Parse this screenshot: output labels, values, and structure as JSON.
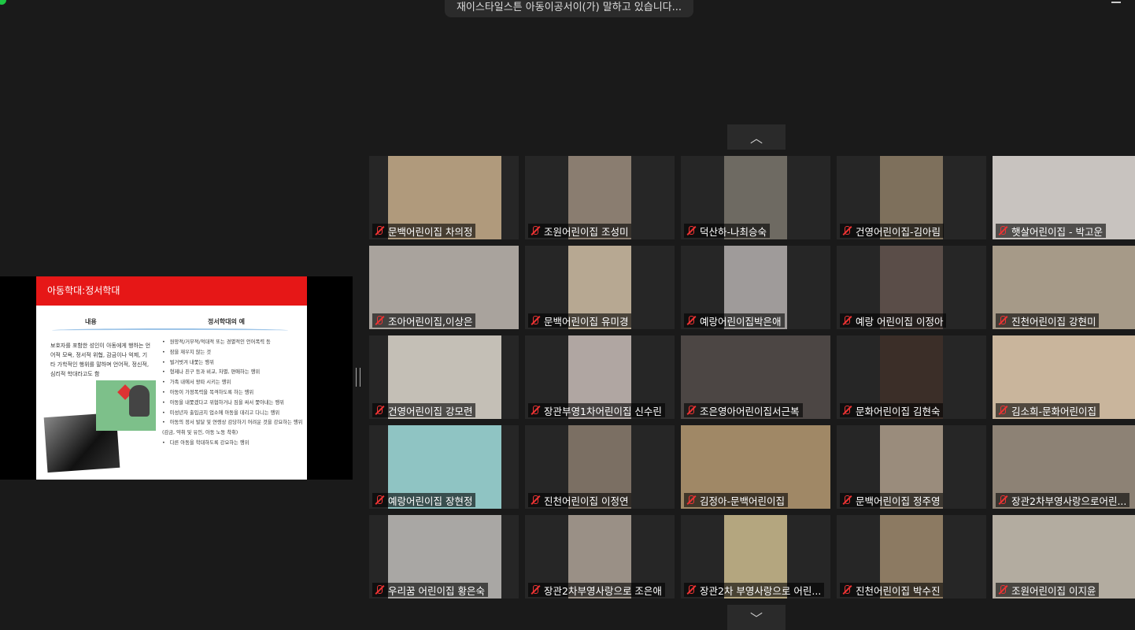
{
  "banner": {
    "text": "재이스타일스튼 아동이공서이(가) 말하고 있습니다..."
  },
  "slide": {
    "title": "아동학대:정서학대",
    "col_left_header": "내용",
    "col_right_header": "정서학대의 예",
    "left_text": "보호자를 포함한 성인이 아동에게 행하는 언어적 모욕, 정서적 위협, 감금이나 억제, 기타 가학적인 행위를 말하며 언어적, 정신적, 심리적 학대라고도 함",
    "items": [
      "원망적/거부적/적대적 또는 경멸적인 언어폭력 등",
      "잠을 재우지 않는 것",
      "벌거벗겨 내쫓는 행위",
      "형제나 친구 등과 비교, 차별, 편애하는 행위",
      "가족 내에서 왕따 시키는 행위",
      "아동이 가정폭력을 목격하도록 하는 행위",
      "아동을 내쫓겠다고 위협하거나 짐을 싸서 쫓아내는 행위",
      "미성년자 출입금지 업소에 아동을 데리고 다니는 행위",
      "아동의 정서 발달 및 연령상 감당하기 어려운 것을 강요하는 행위(감금, 약취 및 유인, 아동 노동 착취)",
      "다른 아동을 학대하도록 강요하는 행위"
    ]
  },
  "participants": [
    {
      "name": "문백어린이집 차의정",
      "bg": "#b09a7c"
    },
    {
      "name": "조원어린이집 조성미",
      "bg": "#8a7d70"
    },
    {
      "name": "덕산하-나최승숙",
      "bg": "#6e6a62"
    },
    {
      "name": "건영어린이집-김아림",
      "bg": "#7e705c"
    },
    {
      "name": "햇살어린이집 - 박고운",
      "bg": "#c8c3bf"
    },
    {
      "name": "조아어린이집,이상은",
      "bg": "#a9a39d"
    },
    {
      "name": "문백어린이집 유미경",
      "bg": "#b7a892"
    },
    {
      "name": "예랑어린이집박은애",
      "bg": "#9f9b9a"
    },
    {
      "name": "예랑 어린이집 이정아",
      "bg": "#5a4d48"
    },
    {
      "name": "진천어린이집 강현미",
      "bg": "#a69a88"
    },
    {
      "name": "건영어린이집 강모련",
      "bg": "#c4bfb6"
    },
    {
      "name": "장관부영1차어린이집 신수린",
      "bg": "#b0a6a2"
    },
    {
      "name": "조은영아어린이집서근복",
      "bg": "#4c4644"
    },
    {
      "name": "문화어린이집 김현숙",
      "bg": "#3b2e28"
    },
    {
      "name": "김소희-문화어린이집",
      "bg": "#c9b59c"
    },
    {
      "name": "예랑어린이집 장현정",
      "bg": "#8fc4c3"
    },
    {
      "name": "진천어린이집 이정연",
      "bg": "#7b6f63"
    },
    {
      "name": "김정아-문백어린이집",
      "bg": "#a08866"
    },
    {
      "name": "문백어린이집 정주영",
      "bg": "#9a8c7c"
    },
    {
      "name": "장관2차부영사랑으로어린...",
      "bg": "#8d8275"
    },
    {
      "name": "우리꿈 어린이집 황은숙",
      "bg": "#a9a7a4"
    },
    {
      "name": "장관2차부영사랑으로 조은애",
      "bg": "#9a9086"
    },
    {
      "name": "장관2차 부영사랑으로 어린...",
      "bg": "#b4a67f"
    },
    {
      "name": "진천어린이집 박수진",
      "bg": "#8c7a62"
    },
    {
      "name": "조원어린이집 이지윤",
      "bg": "#b3aca0"
    }
  ],
  "nav": {
    "up_icon": "chevron-up-icon",
    "down_icon": "chevron-down-icon"
  }
}
